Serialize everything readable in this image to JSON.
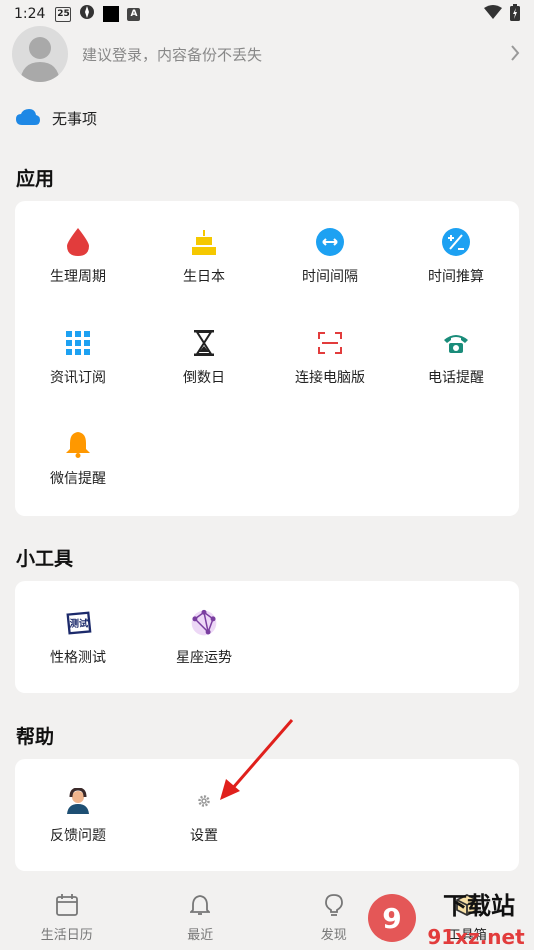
{
  "status": {
    "time": "1:24",
    "date_badge": "25"
  },
  "profile": {
    "login_prompt": "建议登录，内容备份不丢失"
  },
  "todo": {
    "label": "无事项"
  },
  "apps": {
    "title": "应用",
    "items": [
      {
        "label": "生理周期",
        "icon": "blood-drop-icon"
      },
      {
        "label": "生日本",
        "icon": "birthday-cake-icon"
      },
      {
        "label": "时间间隔",
        "icon": "interval-icon"
      },
      {
        "label": "时间推算",
        "icon": "calculator-icon"
      },
      {
        "label": "资讯订阅",
        "icon": "grid-icon"
      },
      {
        "label": "倒数日",
        "icon": "hourglass-icon"
      },
      {
        "label": "连接电脑版",
        "icon": "scan-frame-icon"
      },
      {
        "label": "电话提醒",
        "icon": "phone-icon"
      },
      {
        "label": "微信提醒",
        "icon": "bell-icon"
      }
    ]
  },
  "tools": {
    "title": "小工具",
    "items": [
      {
        "label": "性格测试",
        "icon": "test-stamp-icon"
      },
      {
        "label": "星座运势",
        "icon": "constellation-icon"
      }
    ]
  },
  "help": {
    "title": "帮助",
    "items": [
      {
        "label": "反馈问题",
        "icon": "support-agent-icon"
      },
      {
        "label": "设置",
        "icon": "gear-icon"
      }
    ]
  },
  "nav": {
    "items": [
      {
        "label": "生活日历",
        "icon": "calendar-icon"
      },
      {
        "label": "最近",
        "icon": "bell-icon"
      },
      {
        "label": "发现",
        "icon": "lightbulb-icon"
      },
      {
        "label": "工具箱",
        "icon": "toolbox-icon"
      }
    ]
  },
  "watermark": {
    "text1": "下载站",
    "text2": "91xz.net"
  },
  "colors": {
    "accent": "#1da1f2",
    "red": "#e23c3c",
    "yellow": "#f5c800",
    "arrow": "#e0201c"
  }
}
